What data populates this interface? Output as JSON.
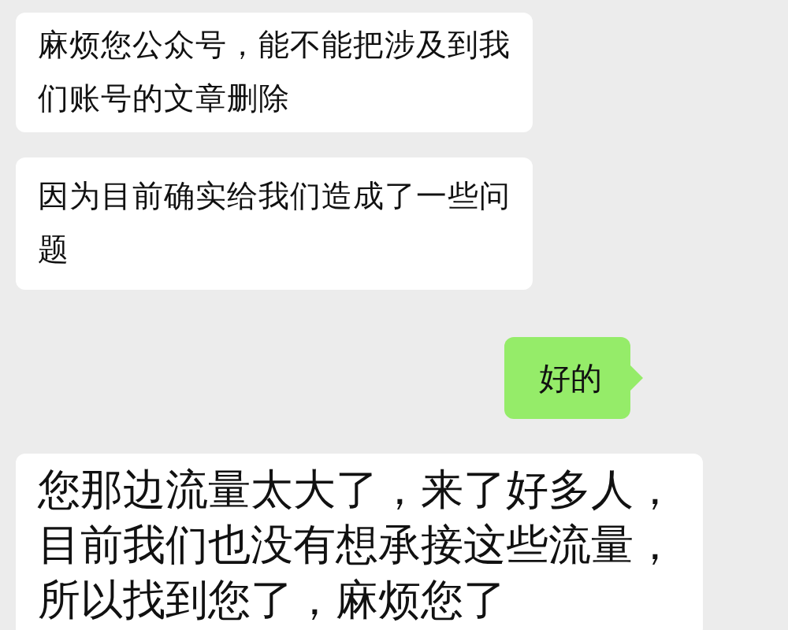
{
  "messages": [
    {
      "outgoing": false,
      "text": "麻烦您公众号，能不能把涉及到我们账号的文章删除"
    },
    {
      "outgoing": false,
      "text": "因为目前确实给我们造成了一些问题"
    },
    {
      "outgoing": true,
      "text": "好的"
    },
    {
      "outgoing": false,
      "text": "您那边流量太大了，来了好多人，目前我们也没有想承接这些流量，所以找到您了，麻烦您了"
    }
  ]
}
